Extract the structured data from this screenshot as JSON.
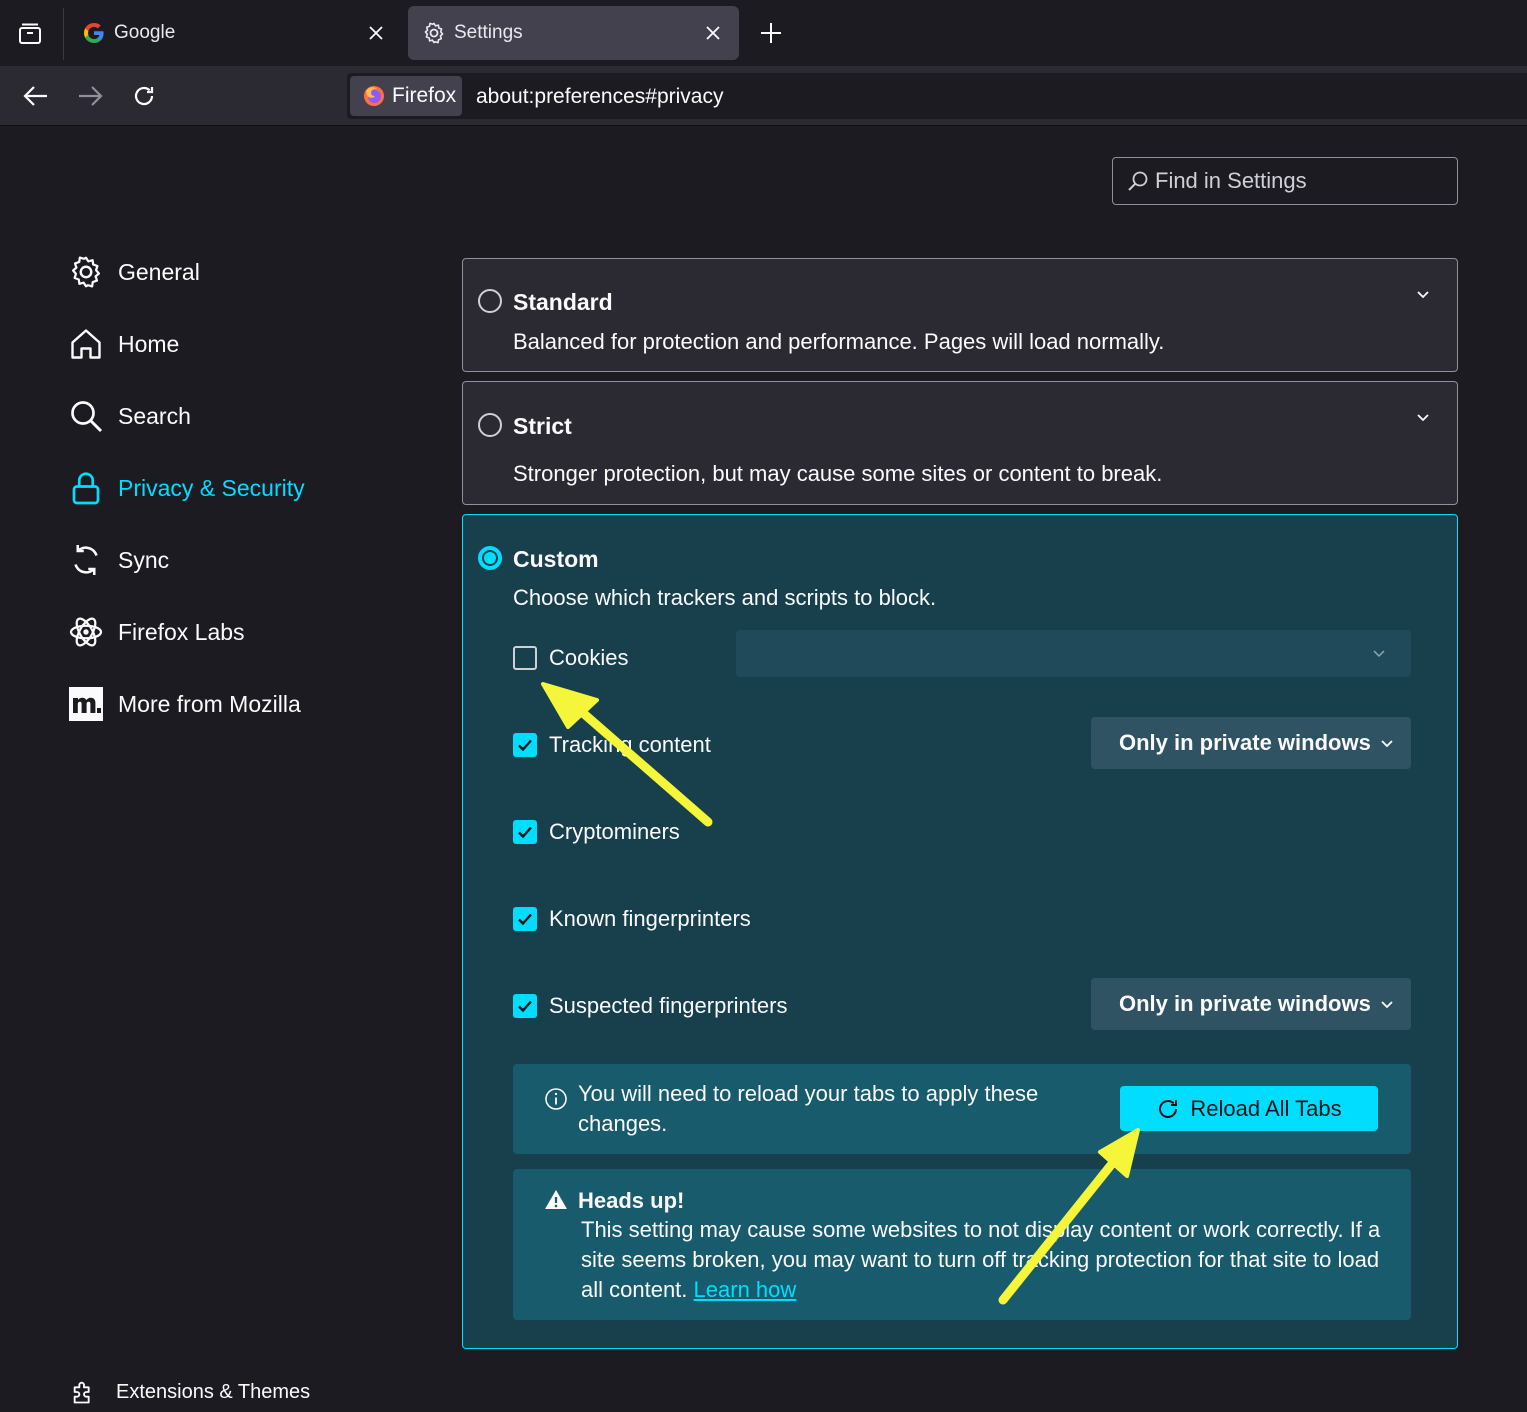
{
  "tabs": [
    {
      "title": "Google"
    },
    {
      "title": "Settings"
    }
  ],
  "navbar": {
    "identity_label": "Firefox",
    "url": "about:preferences#privacy"
  },
  "search": {
    "placeholder": "Find in Settings"
  },
  "sidebar": {
    "items": [
      {
        "label": "General",
        "icon": "gear-icon"
      },
      {
        "label": "Home",
        "icon": "home-icon"
      },
      {
        "label": "Search",
        "icon": "search-icon"
      },
      {
        "label": "Privacy & Security",
        "icon": "lock-icon",
        "selected": true
      },
      {
        "label": "Sync",
        "icon": "sync-icon"
      },
      {
        "label": "Firefox Labs",
        "icon": "atom-icon"
      },
      {
        "label": "More from Mozilla",
        "icon": "mozilla-m-icon"
      }
    ],
    "footer_label": "Extensions & Themes"
  },
  "protection": {
    "standard": {
      "title": "Standard",
      "description": "Balanced for protection and performance. Pages will load normally."
    },
    "strict": {
      "title": "Strict",
      "description": "Stronger protection, but may cause some sites or content to break."
    },
    "custom": {
      "title": "Custom",
      "description": "Choose which trackers and scripts to block.",
      "options": [
        {
          "label": "Cookies",
          "checked": false
        },
        {
          "label": "Tracking content",
          "checked": true,
          "select": "Only in private windows"
        },
        {
          "label": "Cryptominers",
          "checked": true
        },
        {
          "label": "Known fingerprinters",
          "checked": true
        },
        {
          "label": "Suspected fingerprinters",
          "checked": true,
          "select": "Only in private windows"
        }
      ],
      "reload_notice": "You will need to reload your tabs to apply these changes.",
      "reload_button": "Reload All Tabs",
      "warning_title": "Heads up!",
      "warning_text": "This setting may cause some websites to not display content or work correctly. If a site seems broken, you may want to turn off tracking protection for that site to load all content.",
      "warning_link": "Learn how"
    }
  },
  "colors": {
    "accent": "#00ddff",
    "background": "#1c1b22",
    "custom_card": "#173f4c",
    "annotation_arrow": "#f5f53a"
  }
}
